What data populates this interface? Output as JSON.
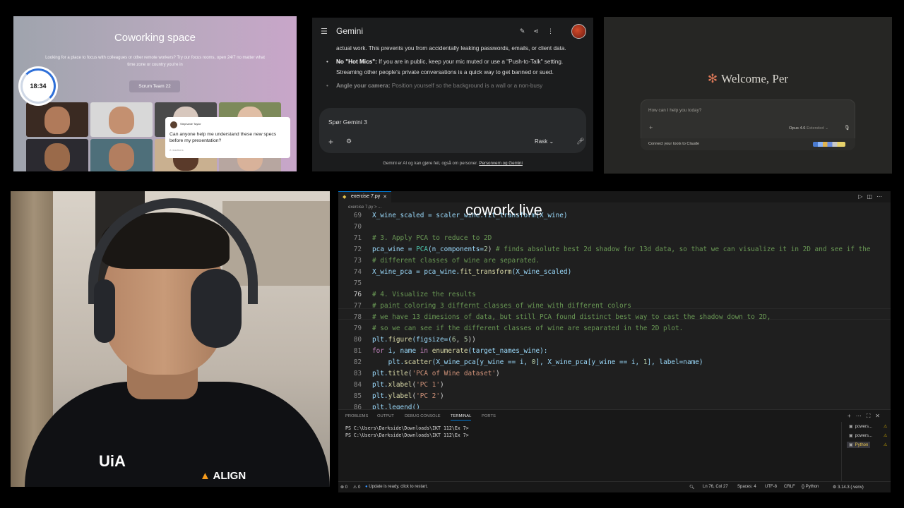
{
  "coworking": {
    "title": "Coworking space",
    "subtitle": "Looking for a place to focus with colleagues or other remote workers? Try our focus rooms, open 24/7 no matter what time zone or country you're in",
    "room_button": "Scrum Team 22",
    "timer": "18:34",
    "chat": {
      "author": "Stephanie Taylor",
      "message": "Can anyone help me understand these new specs before my presentation?",
      "reactions": "2 reactions"
    }
  },
  "gemini": {
    "title": "Gemini",
    "top_icons": [
      "edit-icon",
      "share-icon",
      "more-icon"
    ],
    "para1": "actual work. This prevents you from accidentally leaking passwords, emails, or client data.",
    "bullet1_bold": "No \"Hot Mics\":",
    "bullet1_text": " If you are in public, keep your mic muted or use a \"Push-to-Talk\" setting. Streaming other people's private conversations is a quick way to get banned or sued.",
    "bullet2_bold": "Angle your camera:",
    "bullet2_text": " Position yourself so the background is a wall or a non-busy",
    "input_placeholder": "Spør Gemini 3",
    "mode_label": "Rask",
    "footer_text": "Gemini er AI og kan gjøre feil, også om personer. ",
    "footer_link": "Personvern og Gemini"
  },
  "claude": {
    "welcome": "Welcome, Per",
    "input_placeholder": "How can I help you today?",
    "model": "Opus 4.6",
    "model_mode": "Extended",
    "connect_text": "Connect your tools to Claude"
  },
  "webcam": {
    "shirt_logo": "UiA",
    "shirt_text": "ALIGN"
  },
  "vscode": {
    "tab_name": "exercise 7.py",
    "breadcrumb": "exercise 7.py > ...",
    "overlay_text": "cowork.live",
    "lines": [
      {
        "n": "69",
        "html": "X_wine_scaled"
      },
      {
        "n": "70"
      },
      {
        "n": "71"
      },
      {
        "n": "72"
      },
      {
        "n": "73"
      },
      {
        "n": "74"
      },
      {
        "n": "75"
      },
      {
        "n": "76"
      },
      {
        "n": "77"
      },
      {
        "n": "78"
      },
      {
        "n": "79"
      },
      {
        "n": "80"
      },
      {
        "n": "81"
      },
      {
        "n": "82"
      },
      {
        "n": "83"
      },
      {
        "n": "84"
      },
      {
        "n": "85"
      },
      {
        "n": "86"
      }
    ],
    "code": {
      "l69": "X_wine_scaled = scaler_wine.fit_transform(X_wine)",
      "l71": "# 3. Apply PCA to reduce to 2D",
      "l72a": "pca_wine = ",
      "l72b": "PCA",
      "l72c": "(n_components=",
      "l72d": "2",
      "l72e": ") ",
      "l72f": "# finds absolute best 2d shadow for 13d data, so that we can visualize it in 2D and see if the",
      "l73": "# different classes of wine are separated.",
      "l74a": "X_wine_pca = pca_wine.",
      "l74b": "fit_transform",
      "l74c": "(X_wine_scaled)",
      "l76": "# 4. Visualize the results",
      "l77": "# paint coloring 3 differnt classes of wine with different colors",
      "l78": "# we have 13 dimesions of data, but still PCA found distinct best way to cast the shadow down to 2D,",
      "l79": "# so we can see if the different classes of wine are separated in the 2D plot.",
      "l80a": "plt.",
      "l80b": "figure",
      "l80c": "(figsize=(",
      "l80d": "6",
      "l80e": ", ",
      "l80f": "5",
      "l80g": "))",
      "l81a": "for",
      "l81b": " i, name ",
      "l81c": "in",
      "l81d": " ",
      "l81e": "enumerate",
      "l81f": "(target_names_wine):",
      "l82a": "    plt.",
      "l82b": "scatter",
      "l82c": "(X_wine_pca[y_wine == i, ",
      "l82d": "0",
      "l82e": "], X_wine_pca[y_wine == i, ",
      "l82f": "1",
      "l82g": "], label=name)",
      "l83a": "plt.",
      "l83b": "title",
      "l83c": "(",
      "l83d": "'PCA of Wine dataset'",
      "l83e": ")",
      "l84a": "plt.",
      "l84b": "xlabel",
      "l84c": "(",
      "l84d": "'PC 1'",
      "l84e": ")",
      "l85a": "plt.",
      "l85b": "ylabel",
      "l85c": "(",
      "l85d": "'PC 2'",
      "l85e": ")",
      "l86": "plt.legend()"
    },
    "panel_tabs": [
      "PROBLEMS",
      "OUTPUT",
      "DEBUG CONSOLE",
      "TERMINAL",
      "PORTS"
    ],
    "terminal_lines": [
      "PS C:\\Users\\Darkside\\Downloads\\IKT 112\\Ex 7>",
      "PS C:\\Users\\Darkside\\Downloads\\IKT 112\\Ex 7>"
    ],
    "terminals": [
      "powers...",
      "powers...",
      "Python"
    ],
    "status": {
      "errors": "⊗ 0",
      "warnings": "⚠ 0",
      "update": "Update is ready, click to restart.",
      "position": "Ln 76, Col 27",
      "spaces": "Spaces: 4",
      "encoding": "UTF-8",
      "eol": "CRLF",
      "language": "Python",
      "interpreter": "3.14.3 (.venv)"
    }
  }
}
